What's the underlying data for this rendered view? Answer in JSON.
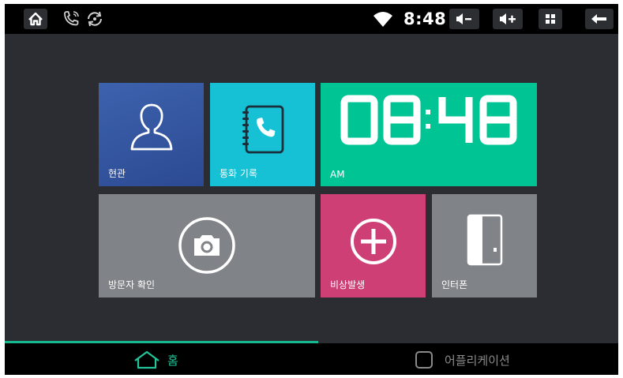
{
  "status_bar": {
    "time": "8:48",
    "icons": [
      "home-icon",
      "call-icon",
      "sync-icon",
      "wifi-icon",
      "volume-down-icon",
      "volume-up-icon",
      "apps-icon",
      "back-icon"
    ]
  },
  "tiles": {
    "hyeongwan": {
      "label": "현관",
      "icon": "person-icon",
      "color": "#3d62ad"
    },
    "call_log": {
      "label": "통화 기록",
      "icon": "phone-book-icon",
      "color": "#16c0d5"
    },
    "clock": {
      "time": "08:48",
      "period": "AM",
      "color": "#00c494"
    },
    "visitor": {
      "label": "방문자 확인",
      "icon": "camera-icon",
      "color": "#808387"
    },
    "emergency": {
      "label": "비상발생",
      "icon": "plus-circle-icon",
      "color": "#cd3f75"
    },
    "intercom": {
      "label": "인터폰",
      "icon": "intercom-icon",
      "color": "#808387"
    }
  },
  "bottom_nav": {
    "home_label": "홈",
    "apps_label": "어플리케이션",
    "active": "home",
    "accent": "#22c59a"
  }
}
